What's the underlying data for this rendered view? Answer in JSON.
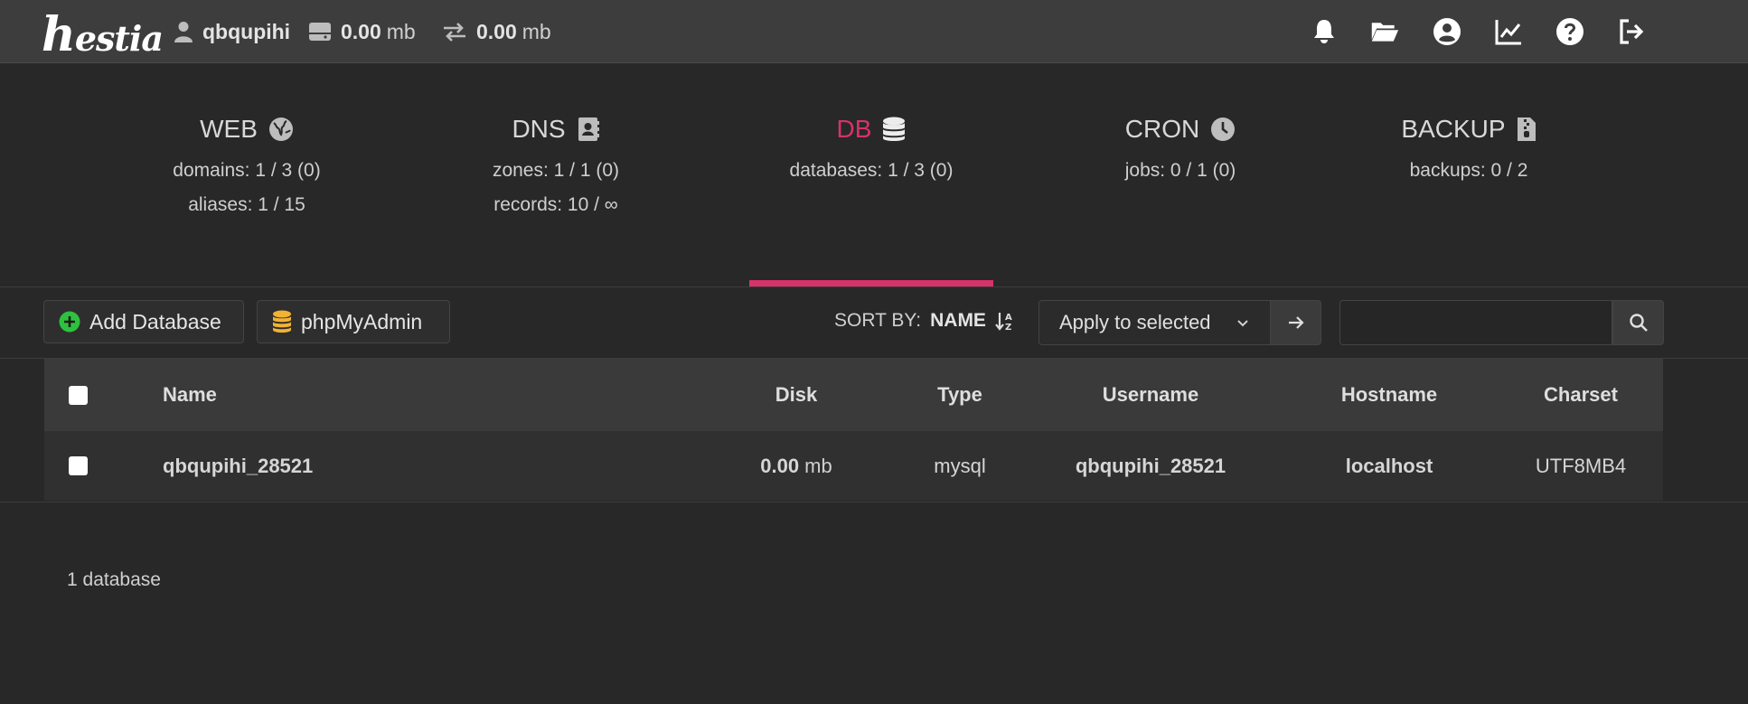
{
  "header": {
    "logo": "hestia",
    "user": "qbqupihi",
    "disk_value": "0.00",
    "disk_unit": "mb",
    "bandwidth_value": "0.00",
    "bandwidth_unit": "mb",
    "icons": [
      "bell-icon",
      "folder-open-icon",
      "user-circle-icon",
      "chart-line-icon",
      "help-icon",
      "logout-icon"
    ]
  },
  "panel": {
    "tabs": [
      {
        "title": "WEB",
        "icon": "globe-icon",
        "lines": [
          "domains: 1 / 3 (0)",
          "aliases: 1 / 15"
        ]
      },
      {
        "title": "DNS",
        "icon": "address-book-icon",
        "lines": [
          "zones: 1 / 1 (0)",
          "records: 10 / ∞"
        ]
      },
      {
        "title": "DB",
        "icon": "database-icon",
        "active": true,
        "lines": [
          "databases: 1 / 3 (0)"
        ]
      },
      {
        "title": "CRON",
        "icon": "clock-icon",
        "lines": [
          "jobs: 0 / 1 (0)"
        ]
      },
      {
        "title": "BACKUP",
        "icon": "file-archive-icon",
        "lines": [
          "backups: 0 / 2"
        ]
      }
    ],
    "accent_color": "#d8326a"
  },
  "toolbar": {
    "add_label": "Add Database",
    "phpmyadmin_label": "phpMyAdmin",
    "sort_by_label": "SORT BY:",
    "sort_by_value": "NAME",
    "apply_select_value": "Apply to selected",
    "search_placeholder": ""
  },
  "table": {
    "headers": [
      "Name",
      "Disk",
      "Type",
      "Username",
      "Hostname",
      "Charset"
    ],
    "rows": [
      {
        "name": "qbqupihi_28521",
        "disk_value": "0.00",
        "disk_unit": "mb",
        "type": "mysql",
        "username": "qbqupihi_28521",
        "hostname": "localhost",
        "charset": "UTF8MB4"
      }
    ]
  },
  "footer": {
    "count_text": "1 database"
  }
}
